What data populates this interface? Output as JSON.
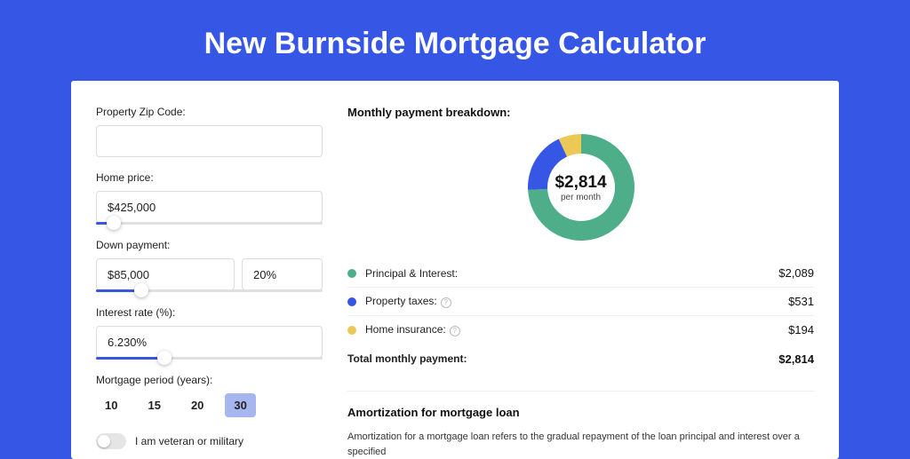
{
  "page_title": "New Burnside Mortgage Calculator",
  "form": {
    "zip_label": "Property Zip Code:",
    "zip_value": "",
    "home_price_label": "Home price:",
    "home_price_value": "$425,000",
    "home_price_slider_pct": 8,
    "down_payment_label": "Down payment:",
    "down_payment_value": "$85,000",
    "down_payment_pct": "20%",
    "down_payment_slider_pct": 20,
    "interest_label": "Interest rate (%):",
    "interest_value": "6.230%",
    "interest_slider_pct": 30,
    "period_label": "Mortgage period (years):",
    "periods": [
      "10",
      "15",
      "20",
      "30"
    ],
    "period_active_index": 3,
    "veteran_label": "I am veteran or military"
  },
  "breakdown": {
    "title": "Monthly payment breakdown:",
    "center_value": "$2,814",
    "center_sub": "per month",
    "rows": [
      {
        "label": "Principal & Interest:",
        "value": "$2,089",
        "color": "#4fae8a",
        "info": false
      },
      {
        "label": "Property taxes:",
        "value": "$531",
        "color": "#3656e6",
        "info": true
      },
      {
        "label": "Home insurance:",
        "value": "$194",
        "color": "#ecc957",
        "info": true
      }
    ],
    "total_label": "Total monthly payment:",
    "total_value": "$2,814"
  },
  "amortization": {
    "title": "Amortization for mortgage loan",
    "text": "Amortization for a mortgage loan refers to the gradual repayment of the loan principal and interest over a specified"
  },
  "chart_data": {
    "type": "pie",
    "title": "Monthly payment breakdown",
    "series": [
      {
        "name": "Principal & Interest",
        "value": 2089,
        "color": "#4fae8a"
      },
      {
        "name": "Property taxes",
        "value": 531,
        "color": "#3656e6"
      },
      {
        "name": "Home insurance",
        "value": 194,
        "color": "#ecc957"
      }
    ],
    "total": 2814,
    "center_label": "$2,814",
    "center_sub": "per month"
  }
}
